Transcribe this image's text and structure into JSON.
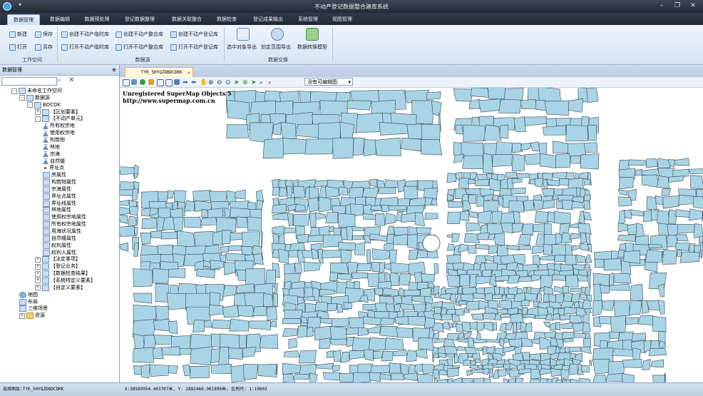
{
  "window": {
    "title": "不动产登记数据整合建库系统",
    "quick_access": "▾"
  },
  "menu": {
    "tabs": [
      "数据管理",
      "数据编辑",
      "数据预处理",
      "登记数据整理",
      "数据关联整合",
      "数据检查",
      "登记成果输出",
      "系统管理",
      "视图管理"
    ],
    "active_index": 0
  },
  "ribbon": {
    "workspace": {
      "label": "工作空间",
      "new": "新建",
      "save": "保存",
      "open": "打开",
      "save_as": "另存"
    },
    "datasource": {
      "label": "数据源",
      "create_temp": "创建不动产临时库",
      "create_merge": "创建不动产整合库",
      "create_reg": "创建不动产登记库",
      "open_temp": "打开不动产临时库",
      "open_merge": "打开不动产整合库",
      "open_reg": "打开不动产登记库"
    },
    "exchange": {
      "label": "数据交换",
      "export_selected": "选中对象导出",
      "export_range": "划定范围导出",
      "convert_model": "数据转换模型"
    }
  },
  "left_panel": {
    "title": "数据管理",
    "search_placeholder": "",
    "tree": [
      {
        "label": "未命名工作空间",
        "level": 0,
        "icon": "workspace",
        "expander": "-"
      },
      {
        "label": "数据源",
        "level": 1,
        "icon": "db",
        "expander": "-"
      },
      {
        "label": "BDCDK",
        "level": 2,
        "icon": "db",
        "expander": "-"
      },
      {
        "label": "【区划要素】",
        "level": 3,
        "icon": "group",
        "expander": "+"
      },
      {
        "label": "【不动产单元】",
        "level": 3,
        "icon": "group",
        "expander": "-"
      },
      {
        "label": "所有权宗地",
        "level": 4,
        "icon": "region"
      },
      {
        "label": "使用权宗地",
        "level": 4,
        "icon": "region"
      },
      {
        "label": "构筑物",
        "level": 4,
        "icon": "region"
      },
      {
        "label": "林地",
        "level": 4,
        "icon": "region"
      },
      {
        "label": "宗海",
        "level": 4,
        "icon": "region"
      },
      {
        "label": "自然幢",
        "level": 4,
        "icon": "region"
      },
      {
        "label": "界址点",
        "level": 4,
        "icon": "point"
      },
      {
        "label": "房属性",
        "level": 4,
        "icon": "table"
      },
      {
        "label": "构筑物属性",
        "level": 4,
        "icon": "table"
      },
      {
        "label": "宗海属性",
        "level": 4,
        "icon": "table"
      },
      {
        "label": "界址点属性",
        "level": 4,
        "icon": "table"
      },
      {
        "label": "界址线属性",
        "level": 4,
        "icon": "table"
      },
      {
        "label": "林地属性",
        "level": 4,
        "icon": "table"
      },
      {
        "label": "使用权宗地属性",
        "level": 4,
        "icon": "table"
      },
      {
        "label": "所有权宗地属性",
        "level": 4,
        "icon": "table"
      },
      {
        "label": "用海状况属性",
        "level": 4,
        "icon": "table"
      },
      {
        "label": "自然幢属性",
        "level": 4,
        "icon": "table"
      },
      {
        "label": "权利属性",
        "level": 4,
        "icon": "table"
      },
      {
        "label": "权利人属性",
        "level": 4,
        "icon": "table"
      },
      {
        "label": "【法定事项】",
        "level": 3,
        "icon": "group",
        "expander": "+"
      },
      {
        "label": "【登记业务】",
        "level": 3,
        "icon": "group",
        "expander": "+"
      },
      {
        "label": "【数据检查结果】",
        "level": 3,
        "icon": "group",
        "expander": "+"
      },
      {
        "label": "【系统特定义要素】",
        "level": 3,
        "icon": "group",
        "expander": "+"
      },
      {
        "label": "【自定义要素】",
        "level": 3,
        "icon": "group",
        "expander": "+"
      },
      {
        "label": "地图",
        "level": 1,
        "icon": "map"
      },
      {
        "label": "布局",
        "level": 1,
        "icon": "layout"
      },
      {
        "label": "三维场景",
        "level": 1,
        "icon": "scene"
      },
      {
        "label": "资源",
        "level": 1,
        "icon": "folder",
        "expander": "+"
      }
    ]
  },
  "document": {
    "tab_label": "TYK_SHYQZDBDCDKK",
    "layer_select": "没有可编辑图",
    "watermark_line1": "Unregistered SuperMap Objects 5",
    "watermark_line2": "http://www.supermap.com.cn"
  },
  "status": {
    "selected_layer": "选择图层:TYK_SHYQZDBDCDKK",
    "coords": "X:38589954.403707米, Y: 2882468.961899米; 比例尺: 1:19602"
  }
}
